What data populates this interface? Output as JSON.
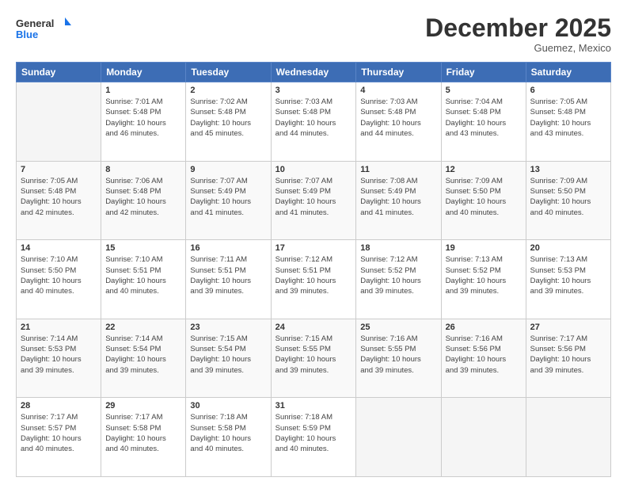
{
  "header": {
    "logo": {
      "line1": "General",
      "line2": "Blue"
    },
    "title": "December 2025",
    "location": "Guemez, Mexico"
  },
  "weekdays": [
    "Sunday",
    "Monday",
    "Tuesday",
    "Wednesday",
    "Thursday",
    "Friday",
    "Saturday"
  ],
  "weeks": [
    [
      {
        "day": "",
        "info": ""
      },
      {
        "day": "1",
        "info": "Sunrise: 7:01 AM\nSunset: 5:48 PM\nDaylight: 10 hours\nand 46 minutes."
      },
      {
        "day": "2",
        "info": "Sunrise: 7:02 AM\nSunset: 5:48 PM\nDaylight: 10 hours\nand 45 minutes."
      },
      {
        "day": "3",
        "info": "Sunrise: 7:03 AM\nSunset: 5:48 PM\nDaylight: 10 hours\nand 44 minutes."
      },
      {
        "day": "4",
        "info": "Sunrise: 7:03 AM\nSunset: 5:48 PM\nDaylight: 10 hours\nand 44 minutes."
      },
      {
        "day": "5",
        "info": "Sunrise: 7:04 AM\nSunset: 5:48 PM\nDaylight: 10 hours\nand 43 minutes."
      },
      {
        "day": "6",
        "info": "Sunrise: 7:05 AM\nSunset: 5:48 PM\nDaylight: 10 hours\nand 43 minutes."
      }
    ],
    [
      {
        "day": "7",
        "info": "Sunrise: 7:05 AM\nSunset: 5:48 PM\nDaylight: 10 hours\nand 42 minutes."
      },
      {
        "day": "8",
        "info": "Sunrise: 7:06 AM\nSunset: 5:48 PM\nDaylight: 10 hours\nand 42 minutes."
      },
      {
        "day": "9",
        "info": "Sunrise: 7:07 AM\nSunset: 5:49 PM\nDaylight: 10 hours\nand 41 minutes."
      },
      {
        "day": "10",
        "info": "Sunrise: 7:07 AM\nSunset: 5:49 PM\nDaylight: 10 hours\nand 41 minutes."
      },
      {
        "day": "11",
        "info": "Sunrise: 7:08 AM\nSunset: 5:49 PM\nDaylight: 10 hours\nand 41 minutes."
      },
      {
        "day": "12",
        "info": "Sunrise: 7:09 AM\nSunset: 5:50 PM\nDaylight: 10 hours\nand 40 minutes."
      },
      {
        "day": "13",
        "info": "Sunrise: 7:09 AM\nSunset: 5:50 PM\nDaylight: 10 hours\nand 40 minutes."
      }
    ],
    [
      {
        "day": "14",
        "info": "Sunrise: 7:10 AM\nSunset: 5:50 PM\nDaylight: 10 hours\nand 40 minutes."
      },
      {
        "day": "15",
        "info": "Sunrise: 7:10 AM\nSunset: 5:51 PM\nDaylight: 10 hours\nand 40 minutes."
      },
      {
        "day": "16",
        "info": "Sunrise: 7:11 AM\nSunset: 5:51 PM\nDaylight: 10 hours\nand 39 minutes."
      },
      {
        "day": "17",
        "info": "Sunrise: 7:12 AM\nSunset: 5:51 PM\nDaylight: 10 hours\nand 39 minutes."
      },
      {
        "day": "18",
        "info": "Sunrise: 7:12 AM\nSunset: 5:52 PM\nDaylight: 10 hours\nand 39 minutes."
      },
      {
        "day": "19",
        "info": "Sunrise: 7:13 AM\nSunset: 5:52 PM\nDaylight: 10 hours\nand 39 minutes."
      },
      {
        "day": "20",
        "info": "Sunrise: 7:13 AM\nSunset: 5:53 PM\nDaylight: 10 hours\nand 39 minutes."
      }
    ],
    [
      {
        "day": "21",
        "info": "Sunrise: 7:14 AM\nSunset: 5:53 PM\nDaylight: 10 hours\nand 39 minutes."
      },
      {
        "day": "22",
        "info": "Sunrise: 7:14 AM\nSunset: 5:54 PM\nDaylight: 10 hours\nand 39 minutes."
      },
      {
        "day": "23",
        "info": "Sunrise: 7:15 AM\nSunset: 5:54 PM\nDaylight: 10 hours\nand 39 minutes."
      },
      {
        "day": "24",
        "info": "Sunrise: 7:15 AM\nSunset: 5:55 PM\nDaylight: 10 hours\nand 39 minutes."
      },
      {
        "day": "25",
        "info": "Sunrise: 7:16 AM\nSunset: 5:55 PM\nDaylight: 10 hours\nand 39 minutes."
      },
      {
        "day": "26",
        "info": "Sunrise: 7:16 AM\nSunset: 5:56 PM\nDaylight: 10 hours\nand 39 minutes."
      },
      {
        "day": "27",
        "info": "Sunrise: 7:17 AM\nSunset: 5:56 PM\nDaylight: 10 hours\nand 39 minutes."
      }
    ],
    [
      {
        "day": "28",
        "info": "Sunrise: 7:17 AM\nSunset: 5:57 PM\nDaylight: 10 hours\nand 40 minutes."
      },
      {
        "day": "29",
        "info": "Sunrise: 7:17 AM\nSunset: 5:58 PM\nDaylight: 10 hours\nand 40 minutes."
      },
      {
        "day": "30",
        "info": "Sunrise: 7:18 AM\nSunset: 5:58 PM\nDaylight: 10 hours\nand 40 minutes."
      },
      {
        "day": "31",
        "info": "Sunrise: 7:18 AM\nSunset: 5:59 PM\nDaylight: 10 hours\nand 40 minutes."
      },
      {
        "day": "",
        "info": ""
      },
      {
        "day": "",
        "info": ""
      },
      {
        "day": "",
        "info": ""
      }
    ]
  ]
}
